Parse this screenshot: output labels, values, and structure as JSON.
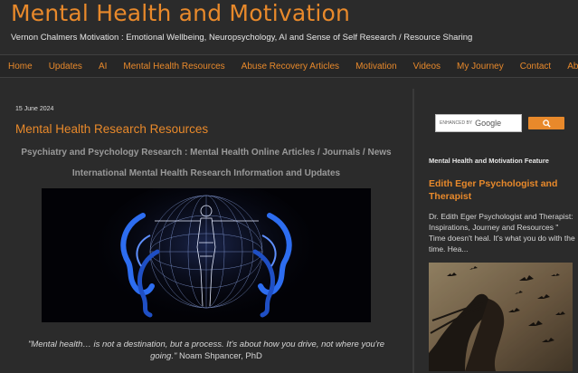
{
  "header": {
    "title": "Mental Health and Motivation",
    "description": "Vernon Chalmers Motivation : Emotional Wellbeing, Neuropsychology, AI and Sense of Self Research / Resource Sharing"
  },
  "nav": {
    "items": [
      "Home",
      "Updates",
      "AI",
      "Mental Health Resources",
      "Abuse Recovery Articles",
      "Motivation",
      "Videos",
      "My Journey",
      "Contact",
      "About"
    ]
  },
  "post": {
    "date": "15 June 2024",
    "title": "Mental Health Research Resources",
    "subtitle1": "Psychiatry and Psychology Research : Mental Health Online Articles / Journals / News",
    "subtitle2": "International Mental Health Research Information and Updates",
    "quote": "\"Mental health… is not a destination, but a process. It's about how you drive, not where you're going.\"",
    "quote_author": "Noam Shpancer, PhD"
  },
  "sidebar": {
    "search": {
      "enhanced_label": "ENHANCED BY",
      "provider": "Google",
      "button_icon": "search-icon"
    },
    "feature_heading": "Mental Health and Motivation Feature",
    "feature_title": "Edith Eger Psychologist and Therapist",
    "feature_snippet": "Dr. Edith Eger Psychologist and Therapist: Inspirations, Journey and Resources  \" Time doesn't heal. It's what you do with the time. Hea..."
  },
  "colors": {
    "accent": "#e8892b",
    "background": "#2b2b2b"
  }
}
